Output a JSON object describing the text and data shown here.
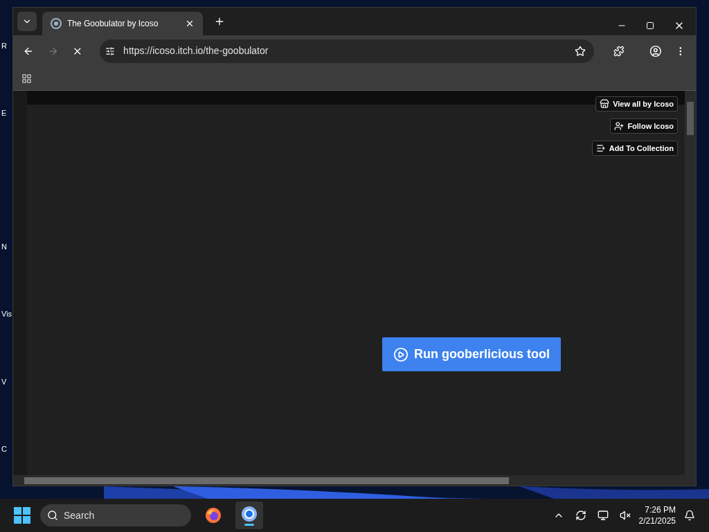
{
  "desktop_icons": [
    {
      "label": "R"
    },
    {
      "label": "E"
    },
    {
      "label": "N"
    },
    {
      "label": "Vis"
    },
    {
      "label": "V"
    },
    {
      "label": "C"
    }
  ],
  "browser": {
    "tabs": [
      {
        "title": "The Goobulator by Icoso",
        "selected": true
      }
    ],
    "loading": true,
    "url": "https://icoso.itch.io/the-goobulator",
    "page": {
      "buttons": [
        {
          "kind": "store",
          "label": "View all by Icoso"
        },
        {
          "kind": "follow",
          "label": "Follow Icoso"
        },
        {
          "kind": "collection",
          "label": "Add To Collection"
        }
      ],
      "run_button": "Run gooberlicious tool"
    }
  },
  "taskbar": {
    "search_placeholder": "Search",
    "apps": [
      {
        "kind": "firefox",
        "selected": false
      },
      {
        "kind": "chrome",
        "selected": true
      }
    ],
    "time": "7:26 PM",
    "date": "2/21/2025"
  }
}
